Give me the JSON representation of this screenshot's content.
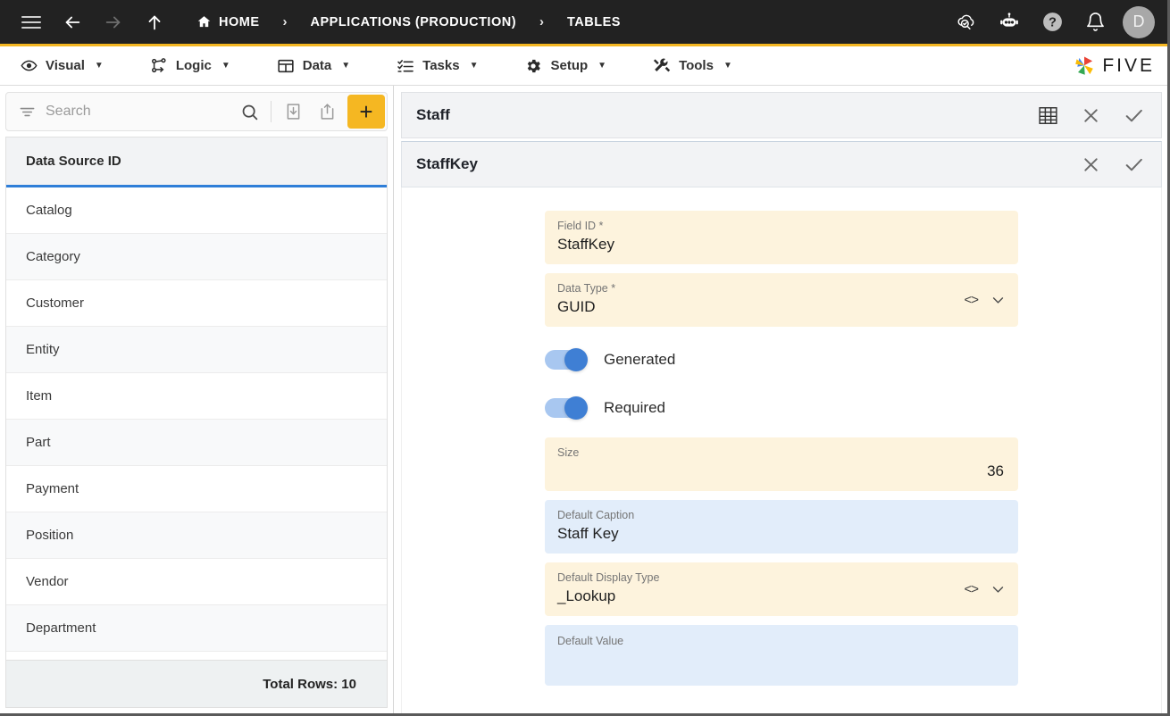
{
  "topbar": {
    "menu_button": "menu",
    "back_label": "back",
    "forward_label": "forward",
    "up_label": "up",
    "breadcrumbs": [
      {
        "label": "HOME",
        "icon": "home-icon"
      },
      {
        "label": "APPLICATIONS (PRODUCTION)",
        "icon": ""
      },
      {
        "label": "TABLES",
        "icon": ""
      }
    ],
    "separator": "›",
    "right_icons": [
      {
        "name": "cloud-check-icon",
        "title": "Cloud"
      },
      {
        "name": "robot-icon",
        "title": "Assistant"
      },
      {
        "name": "help-icon",
        "title": "Help"
      },
      {
        "name": "bell-icon",
        "title": "Notifications"
      }
    ],
    "avatar_initial": "D"
  },
  "menubar": {
    "items": [
      {
        "label": "Visual",
        "icon": "eye-icon",
        "caret": "▼"
      },
      {
        "label": "Logic",
        "icon": "logic-nodes-icon",
        "caret": "▼"
      },
      {
        "label": "Data",
        "icon": "table-icon",
        "caret": "▼"
      },
      {
        "label": "Tasks",
        "icon": "checklist-icon",
        "caret": "▼"
      },
      {
        "label": "Setup",
        "icon": "gear-icon",
        "caret": "▼"
      },
      {
        "label": "Tools",
        "icon": "tools-icon",
        "caret": "▼"
      }
    ],
    "brand": "FIVE"
  },
  "sidebar": {
    "search": {
      "placeholder": "Search",
      "value": ""
    },
    "toolbar": {
      "filter_icon": "filter-icon",
      "search_icon": "search-icon",
      "import_icon": "import-icon",
      "export_icon": "export-icon",
      "add_label": "+"
    },
    "column_header": "Data Source ID",
    "rows": [
      {
        "label": "Catalog"
      },
      {
        "label": "Category"
      },
      {
        "label": "Customer"
      },
      {
        "label": "Entity"
      },
      {
        "label": "Item"
      },
      {
        "label": "Part"
      },
      {
        "label": "Payment"
      },
      {
        "label": "Position"
      },
      {
        "label": "Vendor"
      },
      {
        "label": "Department"
      }
    ],
    "footer": "Total Rows: 10"
  },
  "main": {
    "panel": {
      "title": "Staff",
      "actions": [
        {
          "name": "grid-icon",
          "label": "grid"
        },
        {
          "name": "close-icon",
          "label": "✕"
        },
        {
          "name": "check-icon",
          "label": "✓"
        }
      ]
    },
    "subpanel": {
      "title": "StaffKey",
      "actions": [
        {
          "name": "close-icon",
          "label": "✕"
        },
        {
          "name": "check-icon",
          "label": "✓"
        }
      ]
    },
    "form": {
      "field_id": {
        "label": "Field ID *",
        "value": "StaffKey",
        "style": "amber"
      },
      "data_type": {
        "label": "Data Type *",
        "value": "GUID",
        "style": "amber",
        "adorn": "code-chevron"
      },
      "generated": {
        "label": "Generated",
        "on": true
      },
      "required": {
        "label": "Required",
        "on": true
      },
      "size": {
        "label": "Size",
        "value": "36",
        "style": "amber",
        "align": "right"
      },
      "default_caption": {
        "label": "Default Caption",
        "value": "Staff Key",
        "style": "blue"
      },
      "default_display_type": {
        "label": "Default Display Type",
        "value": "_Lookup",
        "style": "amber",
        "adorn": "code-chevron"
      },
      "default_value": {
        "label": "Default Value",
        "value": "",
        "style": "blue"
      }
    }
  },
  "annotation": {
    "arrow_color": "#e11414",
    "target": "subpanel-check-icon"
  },
  "colors": {
    "topbar_bg": "#222222",
    "accent_yellow": "#F5B722",
    "header_underline_blue": "#2f7ed8",
    "field_amber": "#fdf3dd",
    "field_blue": "#e2edfa",
    "toggle_on": "#3f7fd4"
  }
}
